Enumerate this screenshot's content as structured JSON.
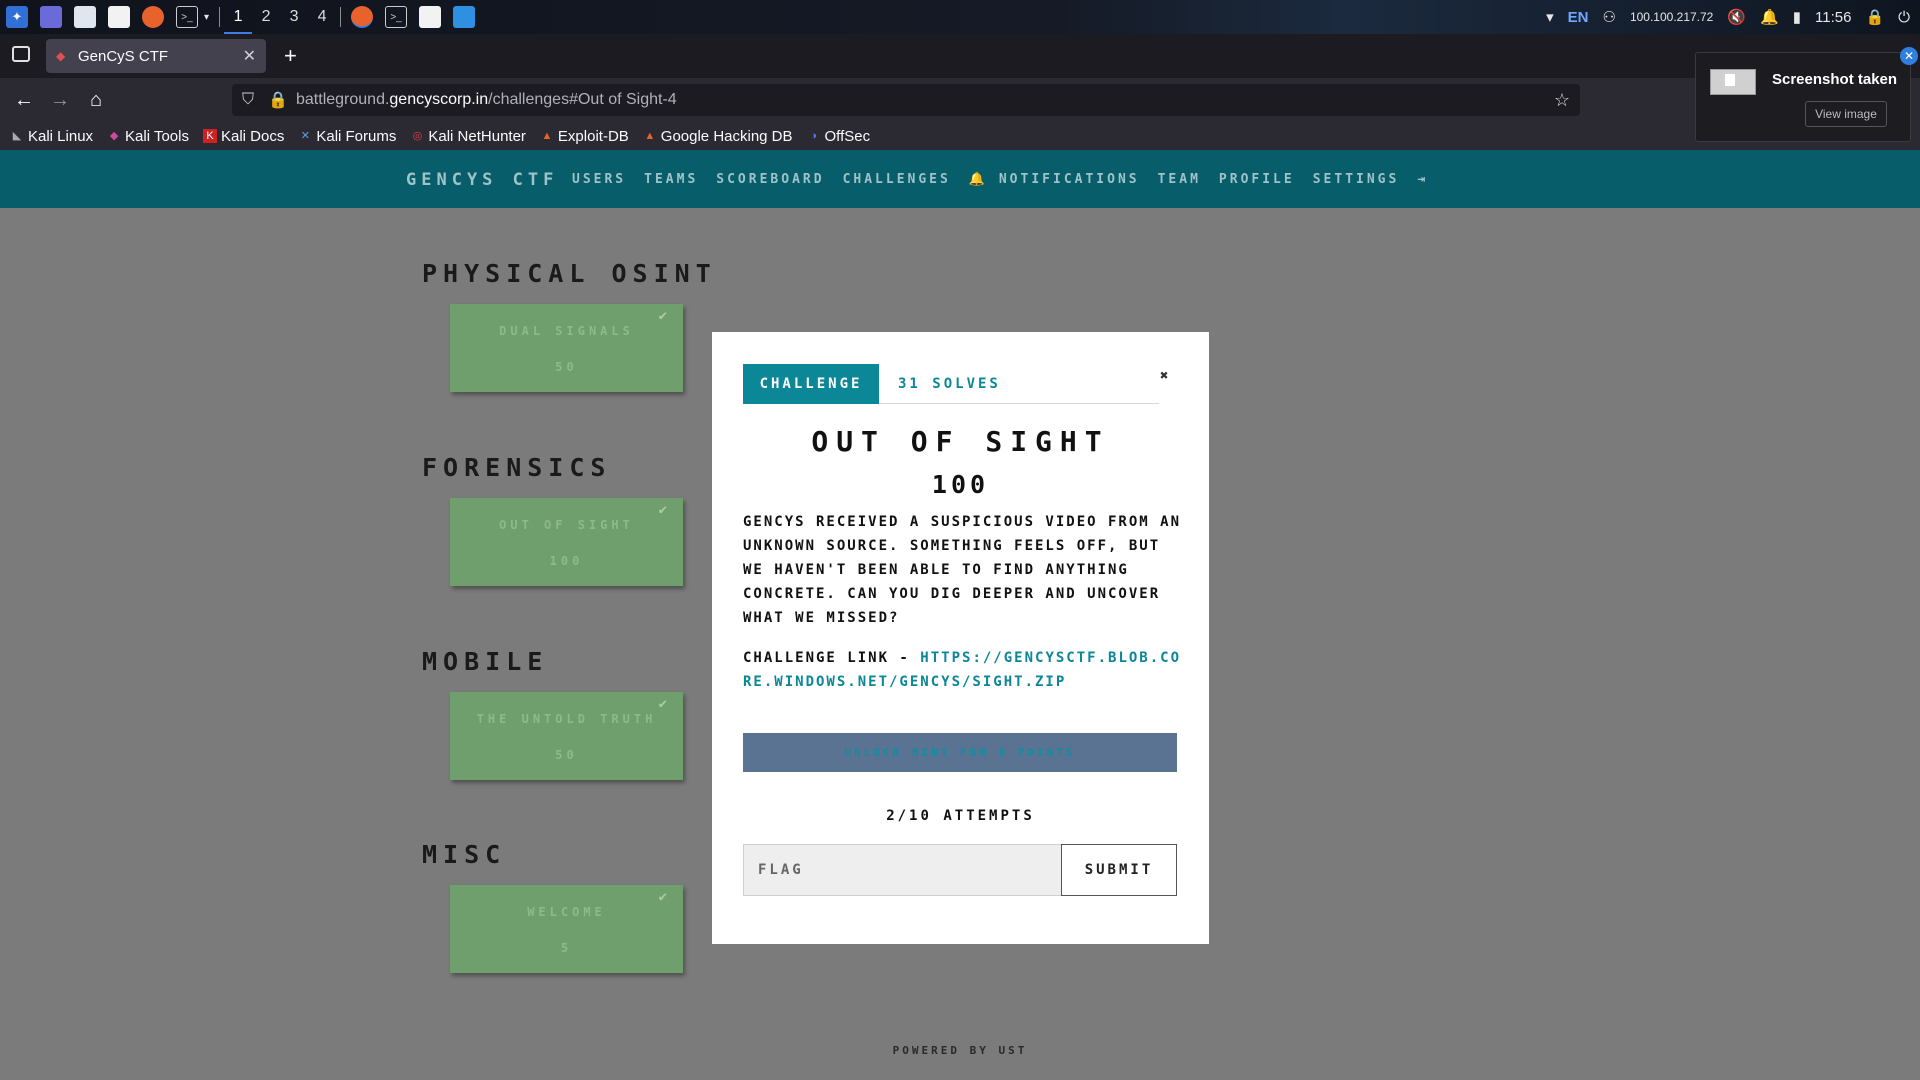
{
  "os": {
    "workspaces": [
      "1",
      "2",
      "3",
      "4"
    ],
    "lang": "EN",
    "ip": "100.100.217.72",
    "time": "11:56"
  },
  "browser": {
    "tab_title": "GenCyS CTF",
    "url_prefix": "battleground.",
    "url_host": "gencyscorp.in",
    "url_path": "/challenges#Out of Sight-4",
    "bookmarks": [
      "Kali Linux",
      "Kali Tools",
      "Kali Docs",
      "Kali Forums",
      "Kali NetHunter",
      "Exploit-DB",
      "Google Hacking DB",
      "OffSec"
    ]
  },
  "site": {
    "brand": "GENCYS CTF",
    "nav": [
      "USERS",
      "TEAMS",
      "SCOREBOARD",
      "CHALLENGES",
      "🔔 NOTIFICATIONS",
      "TEAM",
      "PROFILE",
      "SETTINGS"
    ]
  },
  "categories": [
    {
      "name": "PHYSICAL OSINT",
      "challenge": "DUAL SIGNALS",
      "value": "50"
    },
    {
      "name": "FORENSICS",
      "challenge": "OUT OF SIGHT",
      "value": "100"
    },
    {
      "name": "MOBILE",
      "challenge": "THE UNTOLD TRUTH",
      "value": "50"
    },
    {
      "name": "MISC",
      "challenge": "WELCOME",
      "value": "5"
    }
  ],
  "footer": "POWERED BY UST",
  "modal": {
    "tab_challenge": "CHALLENGE",
    "tab_solves": "31 SOLVES",
    "title": "OUT OF SIGHT",
    "value": "100",
    "description": "GenCyS received a suspicious video from an unknown source. Something feels off, but we haven't been able to find anything concrete. Can you dig deeper and uncover what we missed?",
    "link_label": "Challenge link - ",
    "link_url": "https://gencysctf.blob.core.windows.net/gencys/sight.zip",
    "hint": "UNLOCK HINT FOR 0 POINTS",
    "attempts": "2/10 ATTEMPTS",
    "flag_placeholder": "FLAG",
    "submit": "SUBMIT"
  },
  "notification": {
    "title": "Screenshot taken",
    "button": "View image"
  }
}
